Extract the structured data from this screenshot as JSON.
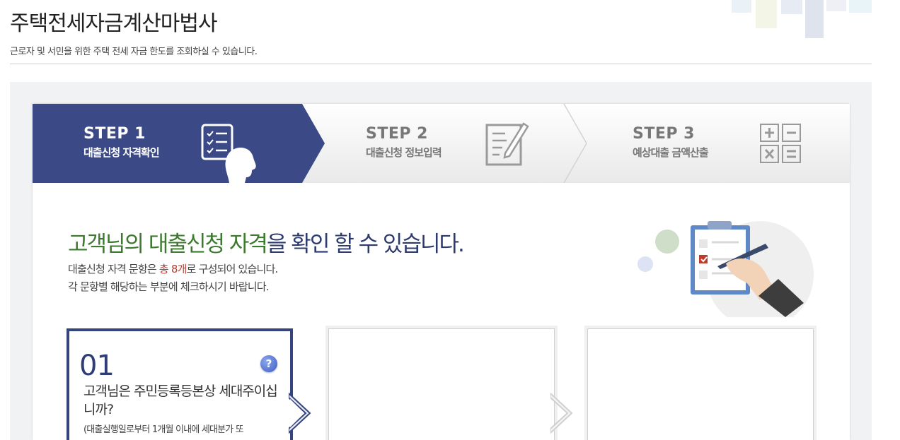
{
  "header": {
    "title": "주택전세자금계산마법사",
    "subtitle": "근로자 및 서민을 위한 주택 전세 자금 한도를 조회하실 수 있습니다."
  },
  "steps": [
    {
      "num": "STEP 1",
      "label": "대출신청 자격확인",
      "state": "active"
    },
    {
      "num": "STEP 2",
      "label": "대출신청 정보입력",
      "state": "inactive"
    },
    {
      "num": "STEP 3",
      "label": "예상대출 금액산출",
      "state": "inactive"
    }
  ],
  "intro": {
    "title_part1": "고객님의 대출신청 자격",
    "title_part2": "을 확인 할 수 있습니다.",
    "line1_a": "대출신청 자격 문항은 ",
    "line1_b": "총 8개",
    "line1_c": "로 구성되어 있습니다.",
    "line2": "각 문항별 해당하는 부분에 체크하시기 바랍니다."
  },
  "questions": [
    {
      "num": "01",
      "text": "고객님은 주민등록등본상 세대주이십니까?",
      "note": "(대출실행일로부터 1개월 이내에 세대분가 또",
      "help": "?"
    }
  ],
  "colors": {
    "active_step": "#3b4a86",
    "brand_green": "#3d7a2f",
    "brand_navy": "#2c3a6e",
    "highlight_red": "#c0392b"
  },
  "icons": [
    "checklist-person-icon",
    "document-pen-icon",
    "calculator-icon",
    "clipboard-illustration",
    "help-icon"
  ]
}
